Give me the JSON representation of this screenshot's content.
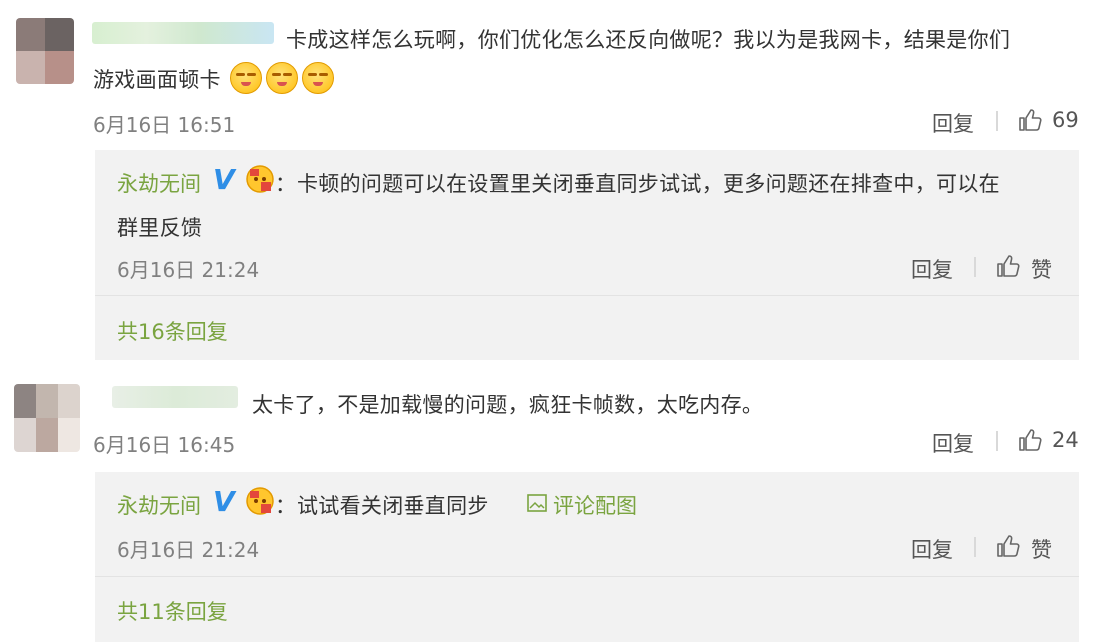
{
  "comments": [
    {
      "text_line1": "卡成这样怎么玩啊，你们优化怎么还反向做呢？我以为是我网卡，结果是你们",
      "text_line2": "游戏画面顿卡",
      "emoji_count": 3,
      "time": "6月16日 16:51",
      "reply_label": "回复",
      "likes": "69",
      "official_reply": {
        "author": "永劫无间",
        "verified": "V",
        "colon": "：",
        "text_line1": "卡顿的问题可以在设置里关闭垂直同步试试，更多问题还在排查中，可以在",
        "text_line2": "群里反馈",
        "time": "6月16日 21:24",
        "reply_label": "回复",
        "like_label": "赞"
      },
      "more_replies": "共16条回复"
    },
    {
      "text_line1": "太卡了，不是加载慢的问题，疯狂卡帧数，太吃内存。",
      "time": "6月16日 16:45",
      "reply_label": "回复",
      "likes": "24",
      "official_reply": {
        "author": "永劫无间",
        "verified": "V",
        "colon": "：",
        "text_line1": "试试看关闭垂直同步",
        "image_link": "评论配图",
        "time": "6月16日 21:24",
        "reply_label": "回复",
        "like_label": "赞"
      },
      "more_replies": "共11条回复"
    }
  ],
  "colors": {
    "official_name": "#7aa440",
    "reply_box_bg": "#f2f2f2",
    "meta_gray": "#808080",
    "verified_blue": "#2f8ee6"
  }
}
